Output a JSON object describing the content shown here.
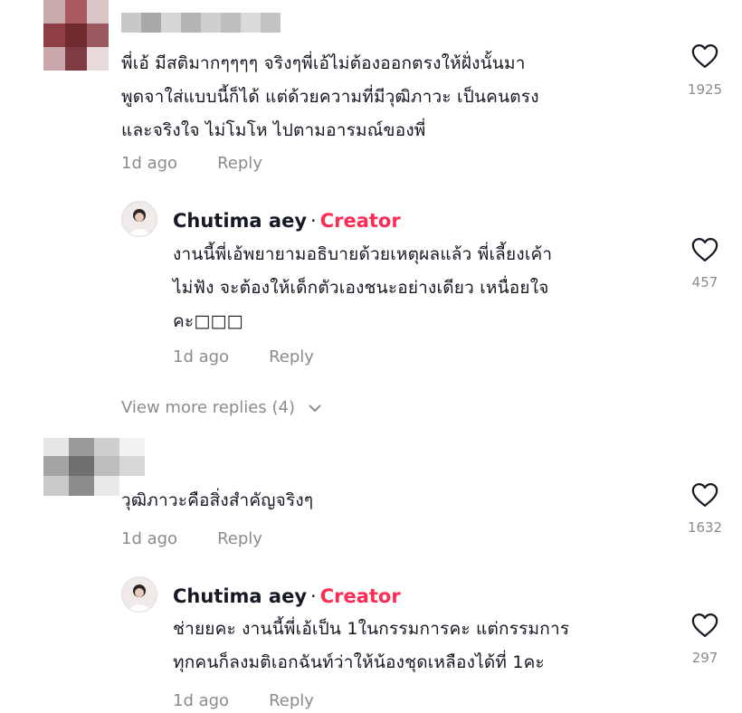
{
  "comments": [
    {
      "text_lines": [
        "พี่เอ้ มีสติมากๆๆๆๆ จริงๆพี่เอ้ไม่ต้องออกตรงให้ฝั่งนั้นมา",
        "พูดจาใส่แบบนี้ก็ได้ แต่ด้วยความที่มีวุฒิภาวะ เป็นคนตรง",
        "และจริงใจ ไม่โมโห ไปตามอารมณ์ของพี่"
      ],
      "time": "1d ago",
      "reply_label": "Reply",
      "likes": "1925",
      "heart_icon": "heart-outline-icon"
    },
    {
      "text_lines": [
        "วุฒิภาวะคือสิ่งสำคัญจริงๆ"
      ],
      "time": "1d ago",
      "reply_label": "Reply",
      "likes": "1632",
      "heart_icon": "heart-outline-icon"
    }
  ],
  "replies": [
    {
      "author": "Chutima aey",
      "separator": "·",
      "badge": "Creator",
      "text_lines": [
        "งานนี้พี่เอ้พยายามอธิบายด้วยเหตุผลแล้ว พี่เลี้ยงเค้า",
        "ไม่ฟัง จะต้องให้เด็กตัวเองชนะอย่างเดียว เหนื่อยใจ",
        "คะ□□□"
      ],
      "time": "1d ago",
      "reply_label": "Reply",
      "likes": "457"
    },
    {
      "author": "Chutima aey",
      "separator": "·",
      "badge": "Creator",
      "text_lines": [
        "ช่ายยคะ งานนี้พี่เอ้เป็น 1ในกรรมการคะ แต่กรรมการ",
        "ทุกคนก็ลงมติเอกฉันท์ว่าให้น้องชุดเหลืองได้ที่ 1คะ"
      ],
      "time": "1d ago",
      "reply_label": "Reply",
      "likes": "297"
    }
  ],
  "view_more": "View more replies (4)",
  "colors": {
    "creator_badge": "#fe2c55",
    "meta": "#8a8b91",
    "text": "#161823"
  }
}
